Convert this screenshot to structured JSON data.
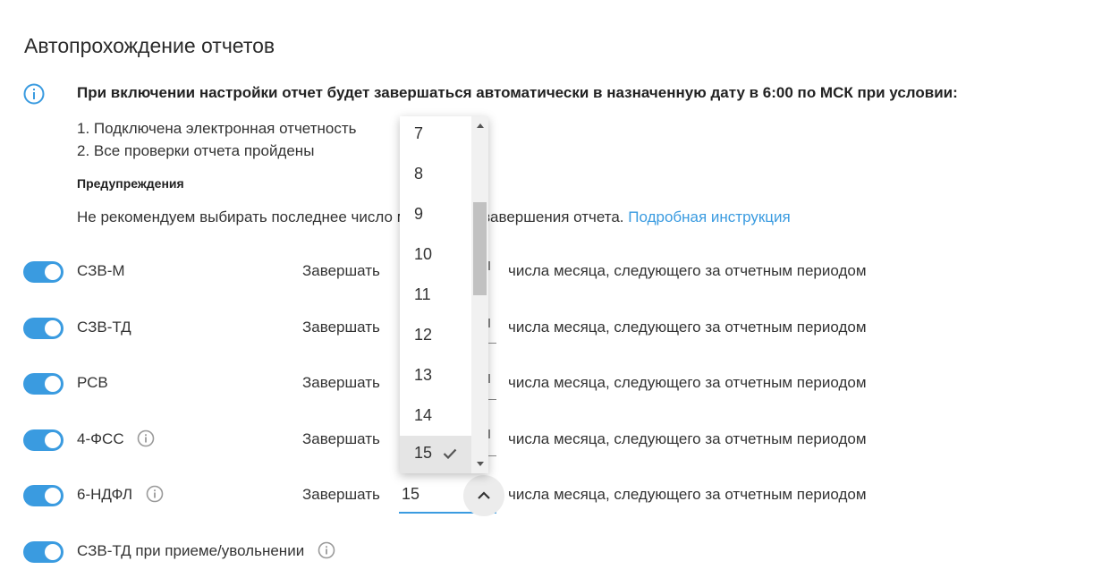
{
  "page": {
    "title": "Автопрохождение отчетов",
    "info_heading": "При включении настройки отчет будет завершаться автоматически в назначенную дату в 6:00 по МСК при условии:",
    "conditions": [
      "1. Подключена электронная отчетность",
      "2. Все проверки отчета пройдены"
    ],
    "warnings_title": "Предупреждения",
    "warning_text": "Не рекомендуем выбирать последнее число месяца для завершения отчета.",
    "warning_link": "Подробная инструкция"
  },
  "rows": [
    {
      "label": "СЗВ-М",
      "enabled": true,
      "has_info": false,
      "finish_label": "Завершать",
      "suffix": "числа месяца, следующего за отчетным периодом"
    },
    {
      "label": "СЗВ-ТД",
      "enabled": true,
      "has_info": false,
      "finish_label": "Завершать",
      "suffix": "числа месяца, следующего за отчетным периодом"
    },
    {
      "label": "РСВ",
      "enabled": true,
      "has_info": false,
      "finish_label": "Завершать",
      "suffix": "числа месяца, следующего за отчетным периодом"
    },
    {
      "label": "4-ФСС",
      "enabled": true,
      "has_info": true,
      "finish_label": "Завершать",
      "suffix": "числа месяца, следующего за отчетным периодом"
    },
    {
      "label": "6-НДФЛ",
      "enabled": true,
      "has_info": true,
      "finish_label": "Завершать",
      "suffix": "числа месяца, следующего за отчетным периодом",
      "selected_day": "15"
    },
    {
      "label": "СЗВ-ТД при приеме/увольнении",
      "enabled": true,
      "has_info": true
    }
  ],
  "dropdown": {
    "options": [
      "7",
      "8",
      "9",
      "10",
      "11",
      "12",
      "13",
      "14",
      "15"
    ],
    "selected": "15"
  },
  "colors": {
    "accent": "#3a9be0",
    "text": "#333333",
    "selected_bg": "#e5e5e5"
  }
}
